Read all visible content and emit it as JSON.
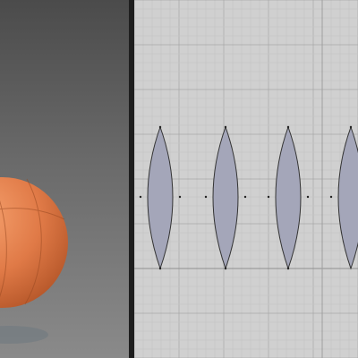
{
  "colors": {
    "viewport_bg_top": "#4b4b4b",
    "viewport_bg_bottom": "#8a8a8a",
    "sphere_color": "#e07a47",
    "uv_canvas_bg": "#d0d0d0",
    "uv_grid_minor": "#c4c4c4",
    "uv_grid_major": "#a9a9a9",
    "uv_shell_fill": "#a4a6b9",
    "uv_shell_stroke": "#333333",
    "splitter": "#1e1e1e"
  },
  "viewport": {
    "object": "sphere",
    "material_color": "#e07a47"
  },
  "uv_editor": {
    "shell_count": 4,
    "shell_shape": "lens"
  }
}
